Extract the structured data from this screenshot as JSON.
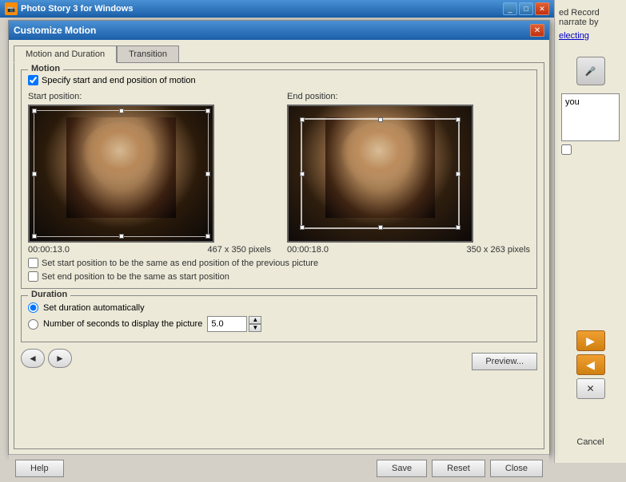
{
  "app": {
    "title": "Photo Story 3 for Windows",
    "icon": "📷"
  },
  "dialog": {
    "title": "Customize Motion",
    "tabs": [
      {
        "id": "motion",
        "label": "Motion and Duration",
        "active": true
      },
      {
        "id": "transition",
        "label": "Transition",
        "active": false
      }
    ],
    "motion_section": {
      "legend": "Motion",
      "specify_label": "Specify start and end position of motion",
      "specify_checked": true,
      "start_label": "Start position:",
      "end_label": "End position:",
      "start_time": "00:00:13.0",
      "start_pixels": "467 x 350 pixels",
      "end_time": "00:00:18.0",
      "end_pixels": "350 x 263 pixels",
      "checkbox1_label": "Set start position to be the same as end position of the previous picture",
      "checkbox2_label": "Set end position to be the same as start position"
    },
    "duration_section": {
      "legend": "Duration",
      "auto_label": "Set duration automatically",
      "auto_checked": true,
      "seconds_label": "Number of seconds to display the picture",
      "seconds_value": "5.0"
    },
    "nav": {
      "prev": "◄",
      "next": "►"
    },
    "preview_btn": "Preview...",
    "footer": {
      "help_label": "Help",
      "save_label": "Save",
      "reset_label": "Reset",
      "close_label": "Close"
    }
  },
  "bg_panel": {
    "text1": "ed Record",
    "text2": "narrate by",
    "link_text": "electing",
    "cancel_label": "Cancel",
    "textarea_text": "you"
  }
}
